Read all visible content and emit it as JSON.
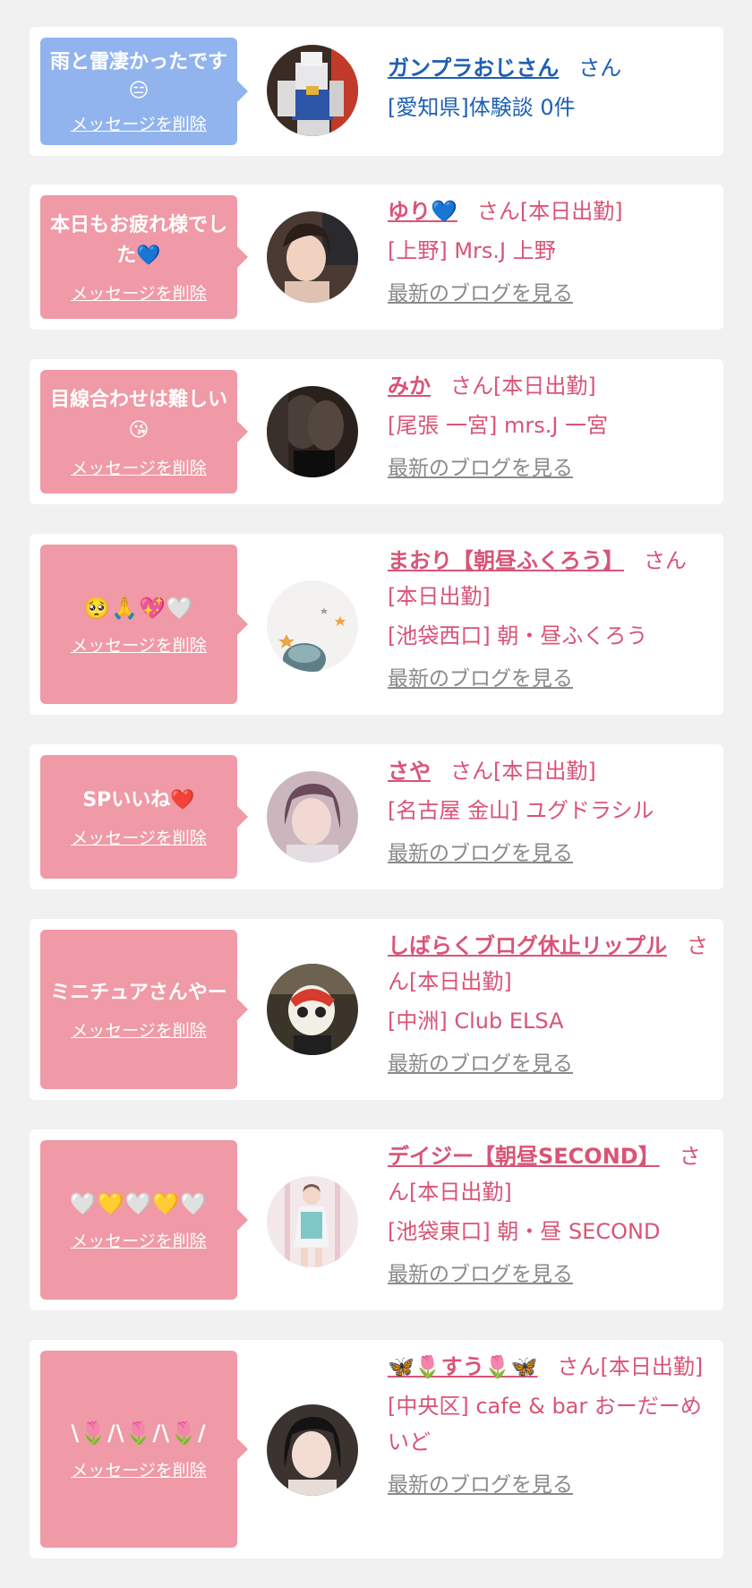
{
  "colors": {
    "page_bg": "#f1f1f1",
    "card_bg": "#ffffff",
    "bubble_pink": "#ef9aa6",
    "bubble_blue": "#92b4ee",
    "text_pink": "#d95476",
    "text_blue": "#1e5fb3",
    "blog_link": "#8a8a8a"
  },
  "delete_label": "メッセージを削除",
  "blog_label": "最新のブログを見る",
  "messages": [
    {
      "message": "雨と雷凄かったです😑",
      "name": "ガンプラおじさん",
      "suffix": "さん",
      "location": "[愛知県]体験談 0件",
      "avatar_icon": "gundam-photo-icon"
    },
    {
      "message": "本日もお疲れ様でした💙",
      "name": "ゆり💙",
      "suffix": "さん[本日出勤]",
      "location": "[上野] Mrs.J 上野",
      "avatar_icon": "woman-photo-icon"
    },
    {
      "message": "目線合わせは難しい😘",
      "name": "みか",
      "suffix": "さん[本日出勤]",
      "location": "[尾張 一宮] mrs.J 一宮",
      "avatar_icon": "legs-photo-icon"
    },
    {
      "message": "🥺🙏💖🤍",
      "name": "まおり【朝昼ふくろう】",
      "suffix": "さん[本日出勤]",
      "location": "[池袋西口] 朝・昼ふくろう",
      "avatar_icon": "stars-photo-icon"
    },
    {
      "message": "SPいいね❤️",
      "name": "さや",
      "suffix": "さん[本日出勤]",
      "location": "[名古屋 金山] ユグドラシル",
      "avatar_icon": "woman-photo-icon"
    },
    {
      "message": "ミニチュアさんやー",
      "name": "しばらくブログ休止リップル",
      "suffix": "さん[本日出勤]",
      "location": "[中洲] Club ELSA",
      "avatar_icon": "mask-photo-icon"
    },
    {
      "message": "🤍💛🤍💛🤍",
      "name": "デイジー【朝昼SECOND】",
      "suffix": "さん[本日出勤]",
      "location": "[池袋東口] 朝・昼 SECOND",
      "avatar_icon": "woman-standing-photo-icon"
    },
    {
      "message": "\\🌷/\\🌷/\\🌷/",
      "name": "🦋🌷すう🌷🦋",
      "suffix": "さん[本日出勤]",
      "location": "[中央区] cafe & bar おーだーめいど",
      "avatar_icon": "woman-photo-icon"
    }
  ]
}
